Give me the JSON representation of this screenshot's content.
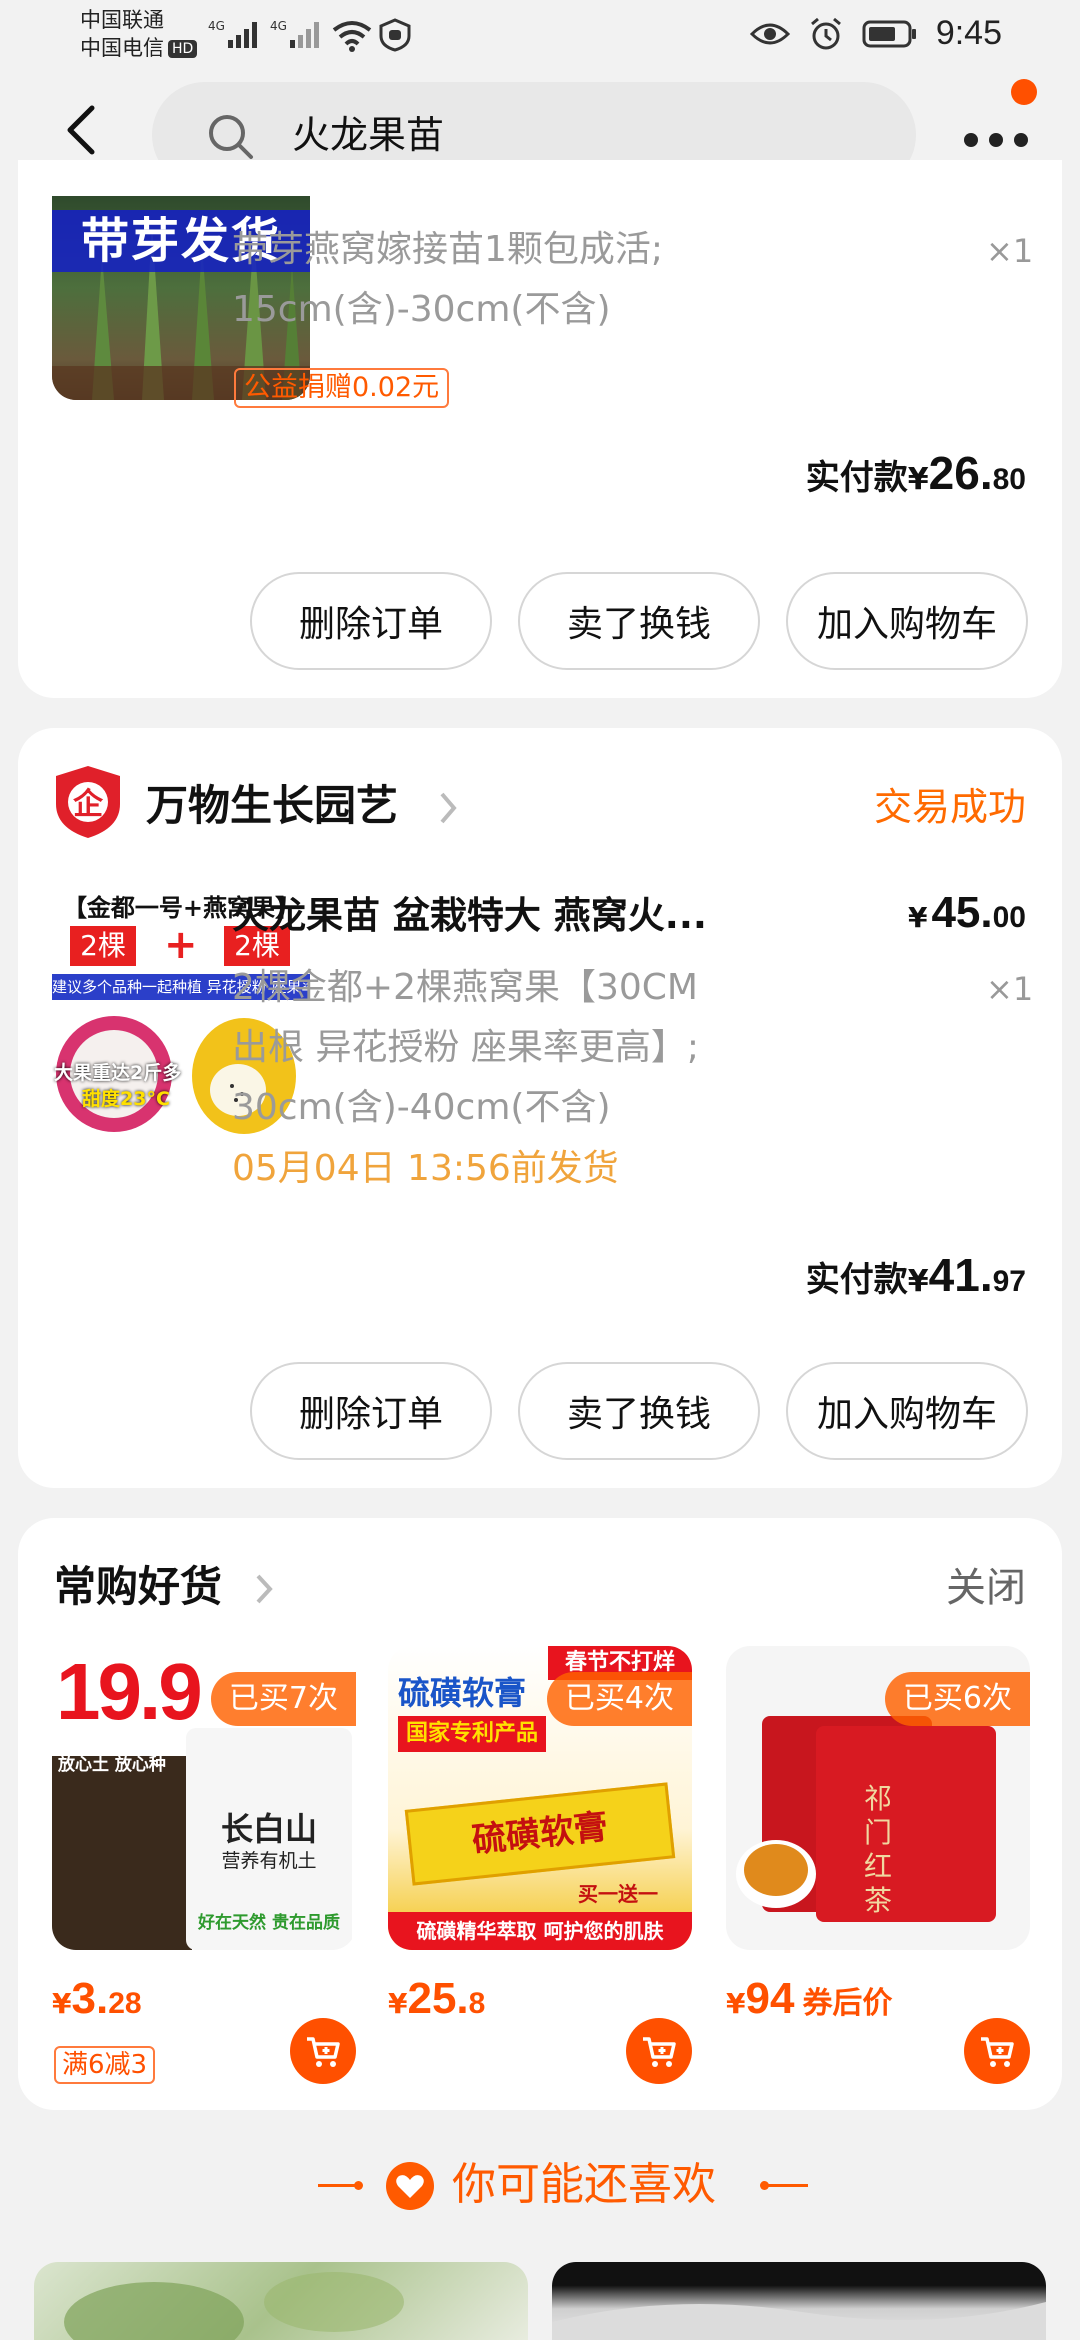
{
  "status_bar": {
    "carrier1": "中国联通",
    "carrier2": "中国电信",
    "hd": "HD",
    "net1": "4G",
    "net2": "4G",
    "time": "9:45"
  },
  "header": {
    "search_value": "火龙果苗"
  },
  "order1": {
    "thumb_text": "带芽发货",
    "spec_line1": "带芽燕窝嫁接苗1颗包成活;",
    "spec_line2": "15cm(含)-30cm(不含)",
    "qty": "×1",
    "charity_tag": "公益捐赠0.02元",
    "paid_label": "实付款",
    "paid_symbol": "¥",
    "paid_int": "26.",
    "paid_dec": "80",
    "buttons": [
      "删除订单",
      "卖了换钱",
      "加入购物车"
    ]
  },
  "order2": {
    "shop_name": "万物生长园艺",
    "status": "交易成功",
    "thumb_title": "【金都一号+燕窝果】",
    "thumb_left": "2棵",
    "thumb_plus": "+",
    "thumb_right": "2棵",
    "thumb_bar": "建议多个品种一起种植 异花授粉 座果率更高",
    "thumb_note1": "大果重达2斤多",
    "thumb_note2": "甜度23°C",
    "title": "火龙果苗 盆栽特大 燕窝火...",
    "price_symbol": "¥",
    "price_int": "45.",
    "price_dec": "00",
    "spec_line1": "2棵金都+2棵燕窝果【30CM",
    "spec_line2": "出根 异花授粉 座果率更高】;",
    "spec_line3": "30cm(含)-40cm(不含)",
    "qty": "×1",
    "ship_note": "05月04日 13:56前发货",
    "paid_label": "实付款",
    "paid_symbol": "¥",
    "paid_int": "41.",
    "paid_dec": "97",
    "buttons": [
      "删除订单",
      "卖了换钱",
      "加入购物车"
    ]
  },
  "frequent": {
    "title": "常购好货",
    "close": "关闭",
    "items": [
      {
        "badge": "已买7次",
        "img_price": "19.9",
        "img_brand": "长白山",
        "img_sub": "营养有机土",
        "img_slogan": "放心土 放心种",
        "img_foot": "好在天然 贵在品质",
        "price_symbol": "¥",
        "price_int": "3.",
        "price_dec": "28",
        "suffix": "",
        "promo": "满6减3"
      },
      {
        "badge": "已买4次",
        "img_title": "硫磺软膏",
        "img_tag": "国家专利产品",
        "img_corner": "春节不打烊",
        "img_box": "硫磺软膏",
        "img_foot": "硫磺精华萃取 呵护您的肌肤",
        "img_bogo": "买一送一",
        "price_symbol": "¥",
        "price_int": "25.",
        "price_dec": "8",
        "suffix": "",
        "promo": ""
      },
      {
        "badge": "已买6次",
        "img_box": "祁门红茶",
        "price_symbol": "¥",
        "price_int": "94",
        "price_dec": "",
        "suffix": "券后价",
        "promo": ""
      }
    ]
  },
  "recommend": {
    "title": "你可能还喜欢"
  }
}
